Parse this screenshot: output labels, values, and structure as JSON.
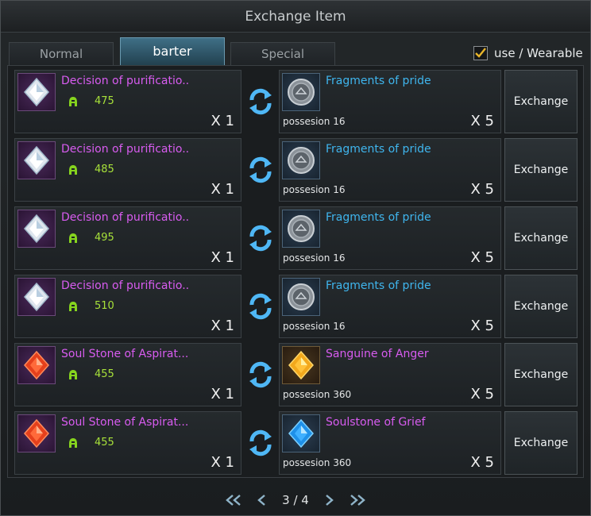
{
  "title": "Exchange Item",
  "tabs": [
    {
      "label": "Normal",
      "active": false
    },
    {
      "label": "barter",
      "active": true
    },
    {
      "label": "Special",
      "active": false
    }
  ],
  "filter": {
    "label": "use / Wearable",
    "checked": true
  },
  "exchange_button_label": "Exchange",
  "rows": [
    {
      "give": {
        "name": "Decision of purificatio..",
        "level": "475",
        "qty": "X 1",
        "icon": "white-crystal-icon"
      },
      "get": {
        "name": "Fragments of pride",
        "possession": "possesion 16",
        "qty": "X 5",
        "icon": "stone-coin-icon"
      }
    },
    {
      "give": {
        "name": "Decision of purificatio..",
        "level": "485",
        "qty": "X 1",
        "icon": "white-crystal-icon"
      },
      "get": {
        "name": "Fragments of pride",
        "possession": "possesion 16",
        "qty": "X 5",
        "icon": "stone-coin-icon"
      }
    },
    {
      "give": {
        "name": "Decision of purificatio..",
        "level": "495",
        "qty": "X 1",
        "icon": "white-crystal-icon"
      },
      "get": {
        "name": "Fragments of pride",
        "possession": "possesion 16",
        "qty": "X 5",
        "icon": "stone-coin-icon"
      }
    },
    {
      "give": {
        "name": "Decision of purificatio..",
        "level": "510",
        "qty": "X 1",
        "icon": "white-crystal-icon"
      },
      "get": {
        "name": "Fragments of pride",
        "possession": "possesion 16",
        "qty": "X 5",
        "icon": "stone-coin-icon"
      }
    },
    {
      "give": {
        "name": "Soul Stone of Aspirat...",
        "level": "455",
        "qty": "X 1",
        "icon": "red-gem-icon"
      },
      "get": {
        "name": "Sanguine of Anger",
        "possession": "possesion 360",
        "qty": "X 5",
        "icon": "yellow-gem-icon"
      }
    },
    {
      "give": {
        "name": "Soul Stone of Aspirat...",
        "level": "455",
        "qty": "X 1",
        "icon": "red-gem-icon"
      },
      "get": {
        "name": "Soulstone of Grief",
        "possession": "possesion 360",
        "qty": "X 5",
        "icon": "blue-gem-icon"
      }
    }
  ],
  "pagination": {
    "current": "3 / 4"
  },
  "colors": {
    "purple_name": "#d85cf0",
    "blue_name": "#3fb6ee",
    "level": "#a8e23a",
    "active_tab": "#3f6f86"
  }
}
